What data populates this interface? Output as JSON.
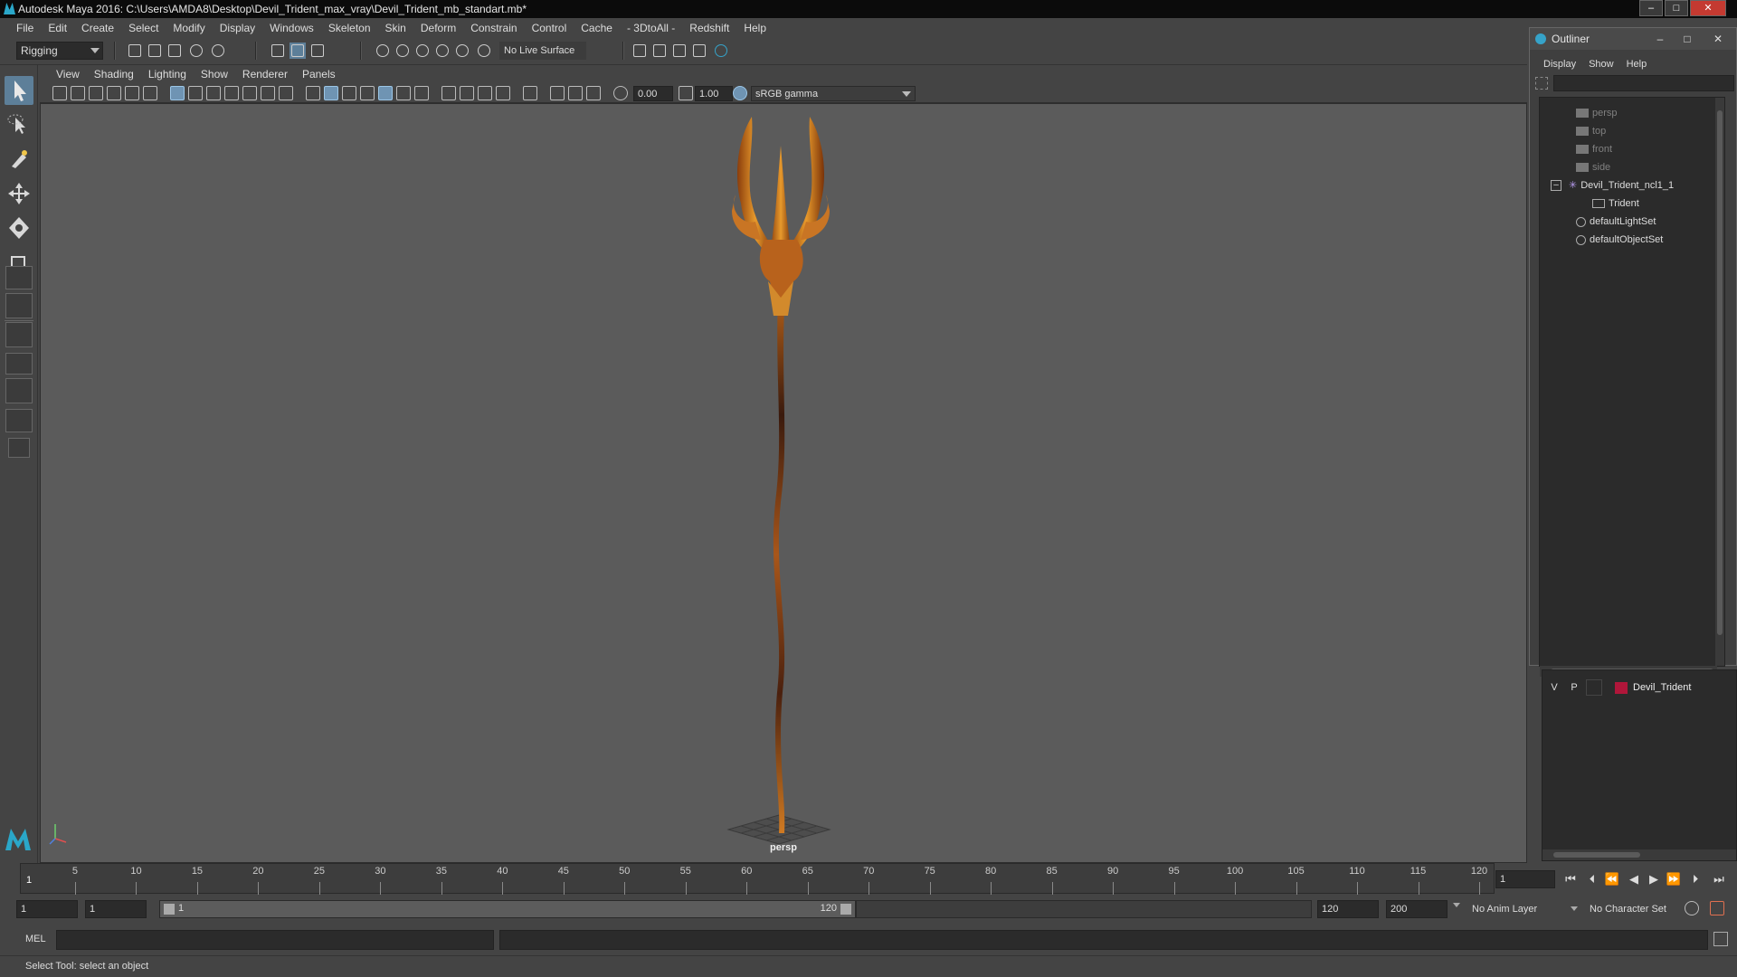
{
  "window": {
    "title": "Autodesk Maya 2016: C:\\Users\\AMDA8\\Desktop\\Devil_Trident_max_vray\\Devil_Trident_mb_standart.mb*",
    "min": "–",
    "max": "□",
    "close": "✕"
  },
  "menubar": [
    "File",
    "Edit",
    "Create",
    "Select",
    "Modify",
    "Display",
    "Windows",
    "Skeleton",
    "Skin",
    "Deform",
    "Constrain",
    "Control",
    "Cache",
    "- 3DtoAll -",
    "Redshift",
    "Help"
  ],
  "statusline": {
    "mode": "Rigging",
    "live_surface": "No Live Surface"
  },
  "panel_menu": [
    "View",
    "Shading",
    "Lighting",
    "Show",
    "Renderer",
    "Panels"
  ],
  "panel_toolbar": {
    "exposure": "0.00",
    "gamma": "1.00",
    "color_space": "sRGB gamma"
  },
  "viewport": {
    "camera": "persp"
  },
  "outliner": {
    "title": "Outliner",
    "menu": [
      "Display",
      "Show",
      "Help"
    ],
    "items": [
      {
        "label": "persp",
        "kind": "camera"
      },
      {
        "label": "top",
        "kind": "camera"
      },
      {
        "label": "front",
        "kind": "camera"
      },
      {
        "label": "side",
        "kind": "camera"
      },
      {
        "label": "Devil_Trident_ncl1_1",
        "kind": "group"
      },
      {
        "label": "Trident",
        "kind": "mesh"
      },
      {
        "label": "defaultLightSet",
        "kind": "set"
      },
      {
        "label": "defaultObjectSet",
        "kind": "set"
      }
    ]
  },
  "layers": {
    "v": "V",
    "p": "P",
    "name": "Devil_Trident",
    "color": "#b0163a"
  },
  "timeline": {
    "ticks": [
      5,
      10,
      15,
      20,
      25,
      30,
      35,
      40,
      45,
      50,
      55,
      60,
      65,
      70,
      75,
      80,
      85,
      90,
      95,
      100,
      105,
      110,
      115,
      120
    ],
    "current": "1",
    "current_field": "1"
  },
  "range": {
    "start": "1",
    "anim_start": "1",
    "slider_start": "1",
    "slider_end": "120",
    "end": "120",
    "anim_end": "200",
    "anim_layer": "No Anim Layer",
    "char_set": "No Character Set"
  },
  "cmdline": {
    "label": "MEL"
  },
  "help": "Select Tool: select an object"
}
